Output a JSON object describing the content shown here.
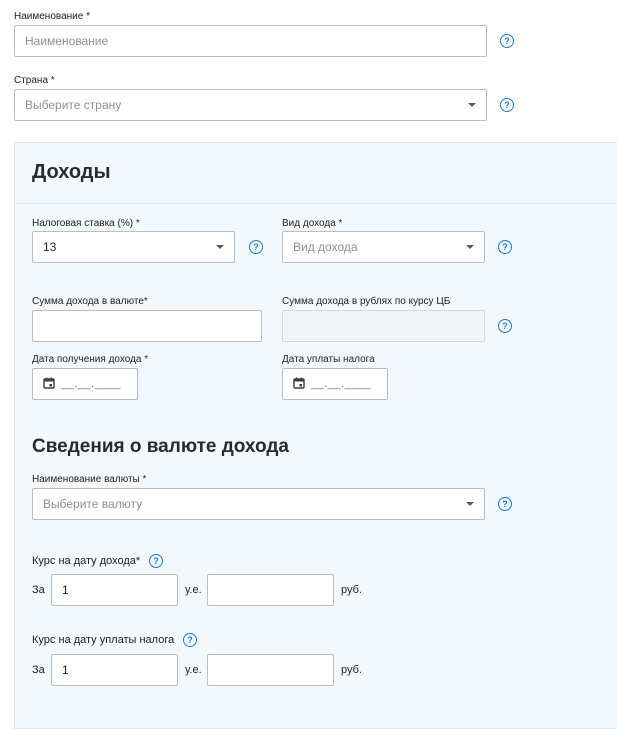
{
  "form": {
    "name_label": "Наименование *",
    "name_placeholder": "Наименование",
    "country_label": "Страна *",
    "country_placeholder": "Выберите страну"
  },
  "income": {
    "title": "Доходы",
    "tax_rate_label": "Налоговая ставка (%) *",
    "tax_rate_value": "13",
    "income_type_label": "Вид дохода *",
    "income_type_placeholder": "Вид дохода",
    "amount_currency_label": "Сумма дохода в валюте*",
    "amount_currency_value": "",
    "amount_rub_label": "Сумма дохода в рублях по курсу ЦБ",
    "amount_rub_value": "",
    "income_date_label": "Дата получения дохода *",
    "income_date_mask": "__.__.____",
    "tax_date_label": "Дата уплаты налога",
    "tax_date_mask": "__.__.____"
  },
  "currency": {
    "title": "Сведения о валюте дохода",
    "currency_name_label": "Наименование валюты *",
    "currency_name_placeholder": "Выберите валюту",
    "rate_income_label": "Курс на дату дохода*",
    "rate_tax_label": "Курс на дату уплаты налога",
    "for_label": "За",
    "units_label": "у.е.",
    "rub_label": "руб.",
    "rate_income_units_value": "1",
    "rate_income_rub_value": "",
    "rate_tax_units_value": "1",
    "rate_tax_rub_value": ""
  },
  "help_glyph": "?",
  "colors": {
    "accent": "#1a7bd0",
    "panel_bg": "#f3f8fd",
    "border": "#b8bec6"
  },
  "icons": [
    "help-icon",
    "calendar-icon",
    "chevron-down-icon"
  ]
}
